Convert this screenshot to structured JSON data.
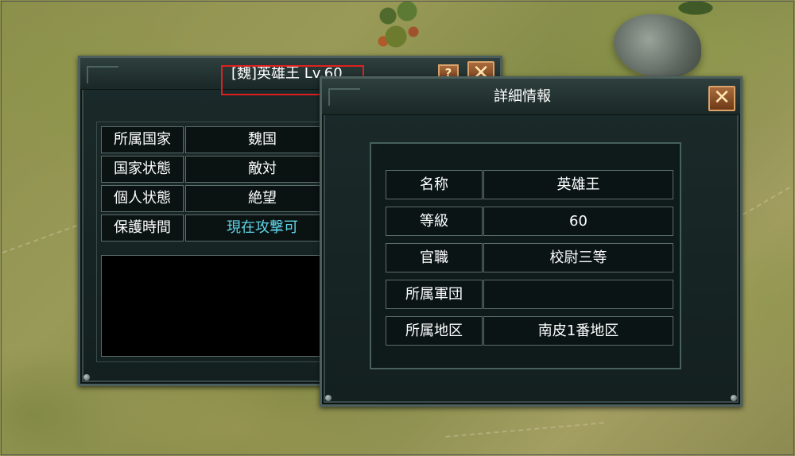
{
  "colors": {
    "panel_bg": "#142020",
    "highlight_cyan": "#5fd4e6",
    "highlight_border": "#e02020",
    "close_button": "#a86b3c"
  },
  "left_panel": {
    "title": "[魏]英雄王 Lv.60",
    "help_label": "?",
    "close_label": "✕",
    "rows": [
      {
        "label": "所属国家",
        "value": "魏国"
      },
      {
        "label": "国家状態",
        "value": "敵対"
      },
      {
        "label": "個人状態",
        "value": "絶望"
      },
      {
        "label": "保護時間",
        "value": "現在攻撃可"
      }
    ]
  },
  "detail_panel": {
    "title": "詳細情報",
    "close_label": "✕",
    "rows": [
      {
        "label": "名称",
        "value": "英雄王"
      },
      {
        "label": "等級",
        "value": "60"
      },
      {
        "label": "官職",
        "value": "校尉三等"
      },
      {
        "label": "所属軍団",
        "value": ""
      },
      {
        "label": "所属地区",
        "value": "南皮1番地区"
      }
    ]
  }
}
